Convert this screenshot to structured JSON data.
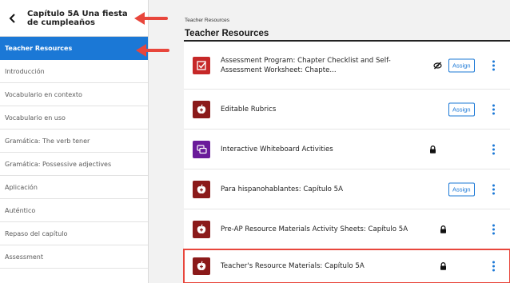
{
  "sidebar": {
    "title": "Capítulo 5A Una fiesta de cumpleaños",
    "items": [
      {
        "label": "Teacher Resources",
        "active": true
      },
      {
        "label": "Introducción"
      },
      {
        "label": "Vocabulario en contexto"
      },
      {
        "label": "Vocabulario en uso"
      },
      {
        "label": "Gramática: The verb tener"
      },
      {
        "label": "Gramática: Possessive adjectives"
      },
      {
        "label": "Aplicación"
      },
      {
        "label": "Auténtico"
      },
      {
        "label": "Repaso del capítulo"
      },
      {
        "label": "Assessment"
      }
    ]
  },
  "main": {
    "breadcrumb": "Teacher Resources",
    "title": "Teacher Resources",
    "assign_label": "Assign",
    "resources": [
      {
        "title_line1": "Assessment Program: Chapter Checklist and Self-",
        "title_line2": "Assessment Worksheet: Chapte...",
        "icon": "checklist-icon",
        "action": "assign",
        "hidden": true
      },
      {
        "title_line1": "Editable Rubrics",
        "icon": "apple-icon",
        "action": "assign"
      },
      {
        "title_line1": "Interactive Whiteboard Activities",
        "icon": "whiteboard-icon",
        "action": "locked"
      },
      {
        "title_line1": "Para hispanohablantes: Capítulo 5A",
        "icon": "apple-icon",
        "action": "assign"
      },
      {
        "title_line1": "Pre-AP Resource Materials Activity Sheets: Capítulo 5A",
        "icon": "apple-icon",
        "action": "locked"
      },
      {
        "title_line1": "Teacher's Resource Materials: Capítulo 5A",
        "icon": "apple-icon",
        "action": "locked",
        "highlighted": true
      }
    ]
  },
  "colors": {
    "accent": "#1b78d6",
    "thumb_red": "#c62828",
    "thumb_dark_red": "#8b1a1a",
    "thumb_purple": "#6a1b9a",
    "annotation": "#e8463c"
  }
}
